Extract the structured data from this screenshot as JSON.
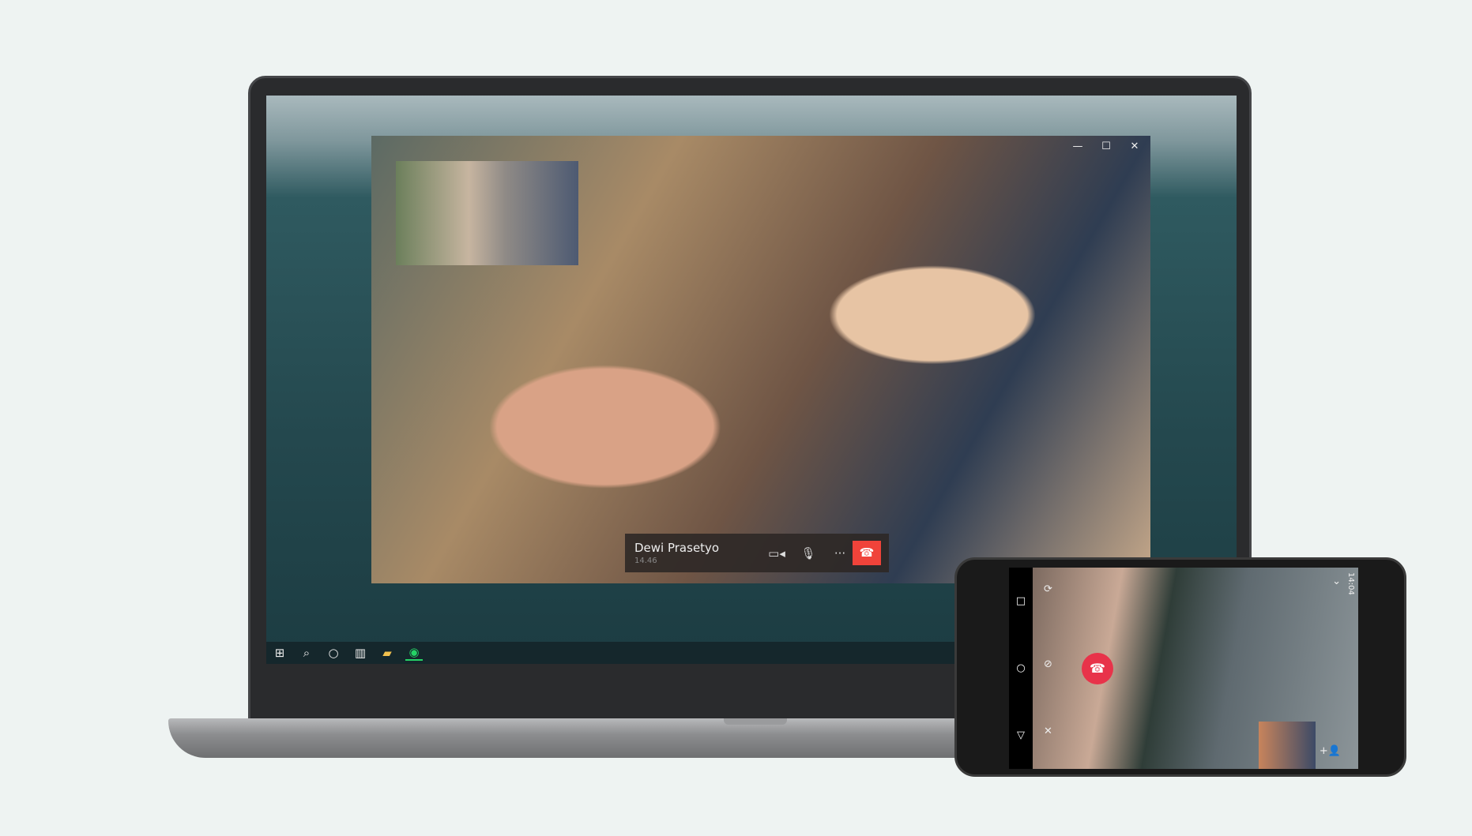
{
  "call_window": {
    "controls": {
      "minimize": "—",
      "maximize": "☐",
      "close": "✕"
    },
    "caller_name": "Dewi Prasetyo",
    "duration": "14.46",
    "buttons": {
      "video": "▭◂",
      "mute": "🎙",
      "more": "···",
      "end": "☎"
    },
    "end_color": "#f0433a"
  },
  "taskbar": {
    "items": [
      "windows-start",
      "search",
      "cortana",
      "task-view",
      "file-explorer",
      "whatsapp"
    ],
    "glyphs": [
      "⊞",
      "⌕",
      "○",
      "▥",
      "▰",
      "◉"
    ]
  },
  "phone": {
    "status_time": "14:04",
    "nav": {
      "recent": "□",
      "home": "○",
      "back": "▽"
    },
    "end_glyph": "☎",
    "end_color": "#e8334a",
    "icons": {
      "switch_camera": "⟳",
      "video_off": "⊘",
      "mute": "✕",
      "add_participant": "+👤",
      "collapse": "⌄"
    }
  }
}
